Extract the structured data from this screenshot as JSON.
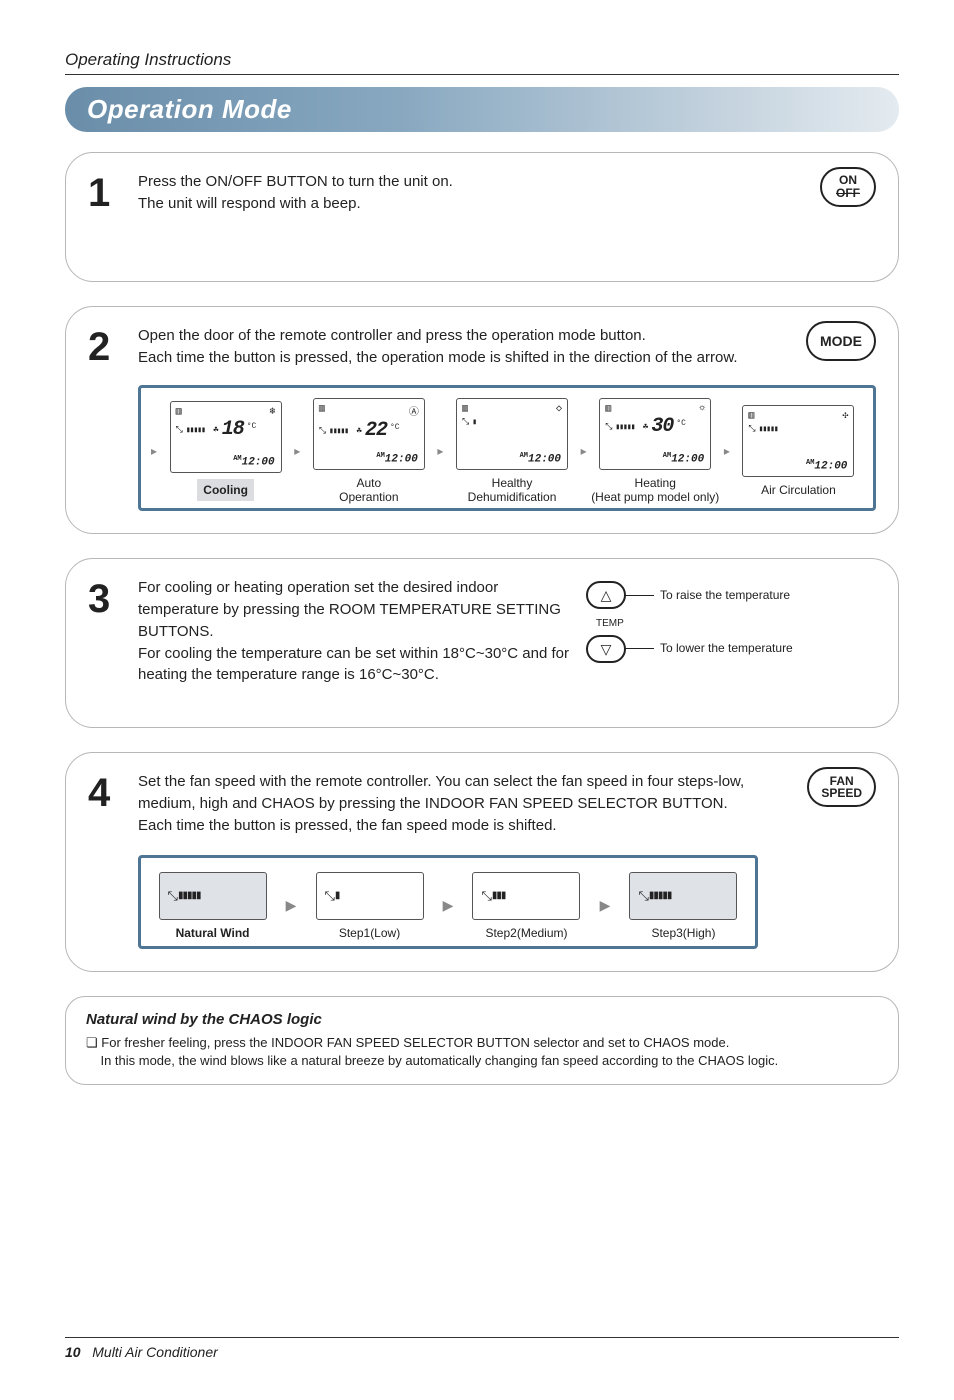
{
  "doc": {
    "header": "Operating Instructions",
    "title": "Operation Mode",
    "footer_page": "10",
    "footer_text": "Multi Air Conditioner"
  },
  "step1": {
    "num": "1",
    "line1": "Press the ON/OFF BUTTON to turn the unit on.",
    "line2": "The unit will respond with a beep.",
    "btn_top": "ON",
    "btn_bot": "OFF"
  },
  "step2": {
    "num": "2",
    "line1": "Open the door of the remote controller and press the operation mode button.",
    "line2": "Each time the button is pressed, the operation mode is shifted in the direction of the arrow.",
    "btn": "MODE",
    "modes": [
      {
        "label": "Cooling",
        "label2": "",
        "boxed": true,
        "temp": "18",
        "showTemp": true,
        "bars": 5,
        "topIcon": "snow"
      },
      {
        "label": "Auto",
        "label2": "Operantion",
        "boxed": false,
        "temp": "22",
        "showTemp": true,
        "bars": 5,
        "topIcon": "A"
      },
      {
        "label": "Healthy",
        "label2": "Dehumidification",
        "boxed": false,
        "temp": "",
        "showTemp": false,
        "bars": 1,
        "topIcon": "drop"
      },
      {
        "label": "Heating",
        "label2": "(Heat pump model only)",
        "boxed": false,
        "temp": "30",
        "showTemp": true,
        "bars": 5,
        "topIcon": "sun"
      },
      {
        "label": "Air Circulation",
        "label2": "",
        "boxed": false,
        "temp": "",
        "showTemp": false,
        "bars": 5,
        "topIcon": "fan"
      }
    ],
    "time": "12:00",
    "time_prefix": "AM"
  },
  "step3": {
    "num": "3",
    "line1": "For cooling or heating operation set the desired indoor temperature by pressing the ROOM TEMPERATURE SETTING BUTTONS.",
    "line2": "For cooling the temperature can be set within 18°C~30°C and for heating the temperature range is 16°C~30°C.",
    "up_sym": "△",
    "down_sym": "▽",
    "raise": "To raise the temperature",
    "lower": "To lower the temperature",
    "temp_mid": "TEMP"
  },
  "step4": {
    "num": "4",
    "line1": "Set the fan speed with the remote controller. You can select the fan speed in four steps-low, medium, high and CHAOS by pressing the INDOOR FAN SPEED SELECTOR BUTTON.",
    "line2": "Each time the button is pressed, the fan speed mode is shifted.",
    "btn_top": "FAN",
    "btn_bot": "SPEED",
    "fans": [
      {
        "bars": 5,
        "swirl": true,
        "label": "Natural Wind",
        "bold": true,
        "grey": true
      },
      {
        "bars": 1,
        "swirl": false,
        "label": "Step1(Low)",
        "bold": false,
        "grey": false
      },
      {
        "bars": 3,
        "swirl": false,
        "label": "Step2(Medium)",
        "bold": false,
        "grey": false
      },
      {
        "bars": 5,
        "swirl": true,
        "label": "Step3(High)",
        "bold": false,
        "grey": true
      }
    ]
  },
  "chaos": {
    "title": "Natural wind by the CHAOS logic",
    "bullet": "❏",
    "line1": "For fresher feeling, press the INDOOR FAN SPEED SELECTOR BUTTON selector and set to CHAOS mode.",
    "line2": "In this mode, the wind blows like a natural breeze by automatically changing fan speed according to the CHAOS logic."
  }
}
